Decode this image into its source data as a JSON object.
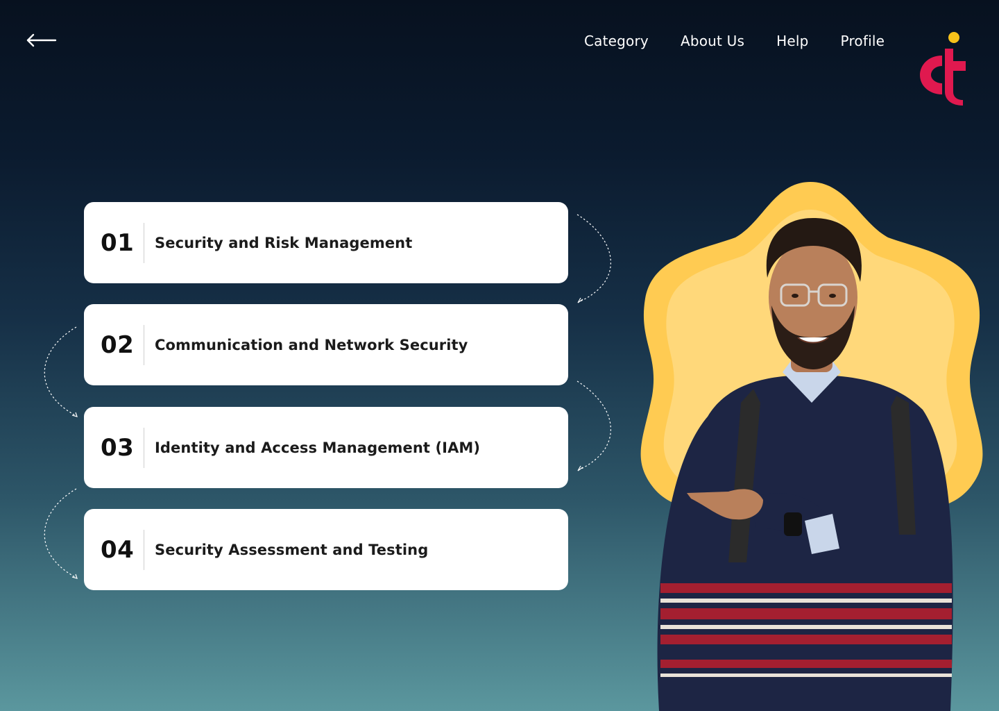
{
  "header": {
    "back_icon": "arrow-left-icon",
    "nav": [
      "Category",
      "About Us",
      "Help",
      "Profile"
    ],
    "logo_colors": {
      "primary": "#e0194f",
      "dot": "#f7c21a"
    }
  },
  "steps": [
    {
      "number": "01",
      "label": "Security and Risk Management"
    },
    {
      "number": "02",
      "label": "Communication and Network Security"
    },
    {
      "number": "03",
      "label": "Identity and Access Management (IAM)"
    },
    {
      "number": "04",
      "label": "Security Assessment and Testing"
    }
  ],
  "colors": {
    "bg_top": "#07111f",
    "bg_bottom": "#5b979e",
    "card": "#ffffff",
    "blob_outer": "#ffcb52",
    "blob_inner": "#ffd87a"
  }
}
